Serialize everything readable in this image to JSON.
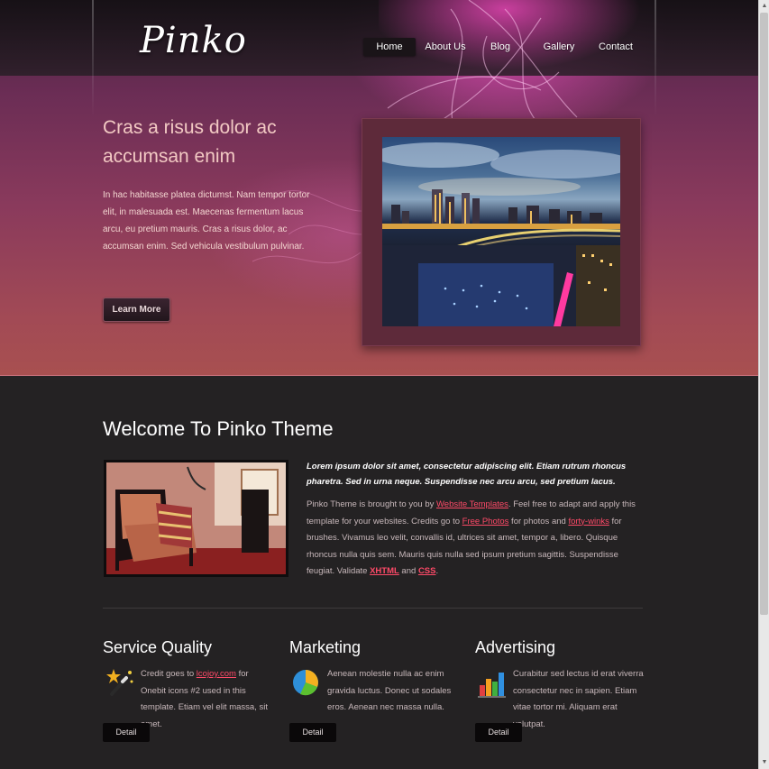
{
  "header": {
    "logo": "Pinko",
    "nav": [
      {
        "label": "Home",
        "active": true
      },
      {
        "label": "About Us",
        "active": false
      },
      {
        "label": "Blog",
        "active": false
      },
      {
        "label": "Gallery",
        "active": false
      },
      {
        "label": "Contact",
        "active": false
      }
    ]
  },
  "hero": {
    "title": "Cras a risus dolor ac accumsan enim",
    "text": "In hac habitasse platea dictumst. Nam tempor tortor elit, in malesuada est. Maecenas fermentum lacus arcu, eu pretium mauris. Cras a risus dolor, ac accumsan enim. Sed vehicula vestibulum pulvinar.",
    "button_label": "Learn More"
  },
  "welcome": {
    "title": "Welcome To Pinko Theme",
    "lead": "Lorem ipsum dolor sit amet, consectetur adipiscing elit. Etiam rutrum rhoncus pharetra. Sed in urna neque. Suspendisse nec arcu arcu, sed pretium lacus.",
    "body": {
      "t1": "Pinko Theme is brought to you by ",
      "link1": "Website Templates",
      "t2": ". Feel free to adapt and apply this template for your websites. Credits go to ",
      "link2": "Free Photos",
      "t3": " for photos and ",
      "link3": "forty-winks",
      "t4": " for brushes. Vivamus leo velit, convallis id, ultrices sit amet, tempor a, libero. Quisque rhoncus nulla quis sem. Mauris quis nulla sed ipsum pretium sagittis. Suspendisse feugiat. Validate ",
      "link4": "XHTML",
      "t5": " and ",
      "link5": "CSS",
      "t6": "."
    }
  },
  "columns": [
    {
      "title": "Service Quality",
      "icon": "magic-wand-icon",
      "text_before": "Credit goes to ",
      "link": "lcojoy.com",
      "text_after": " for Onebit icons #2 used in this template. Etiam vel elit massa, sit amet.",
      "button_label": "Detail"
    },
    {
      "title": "Marketing",
      "icon": "pie-chart-icon",
      "text": "Aenean molestie nulla ac enim gravida luctus. Donec ut sodales eros. Aenean nec massa nulla.",
      "button_label": "Detail"
    },
    {
      "title": "Advertising",
      "icon": "bar-chart-icon",
      "text": "Curabitur sed lectus id erat viverra consectetur nec in sapien. Etiam vitae tortor mi. Aliquam erat volutpat.",
      "button_label": "Detail"
    }
  ],
  "colors": {
    "accent_link": "#ff4a68",
    "hero_pink": "#e650b4",
    "content_bg": "#242223"
  }
}
